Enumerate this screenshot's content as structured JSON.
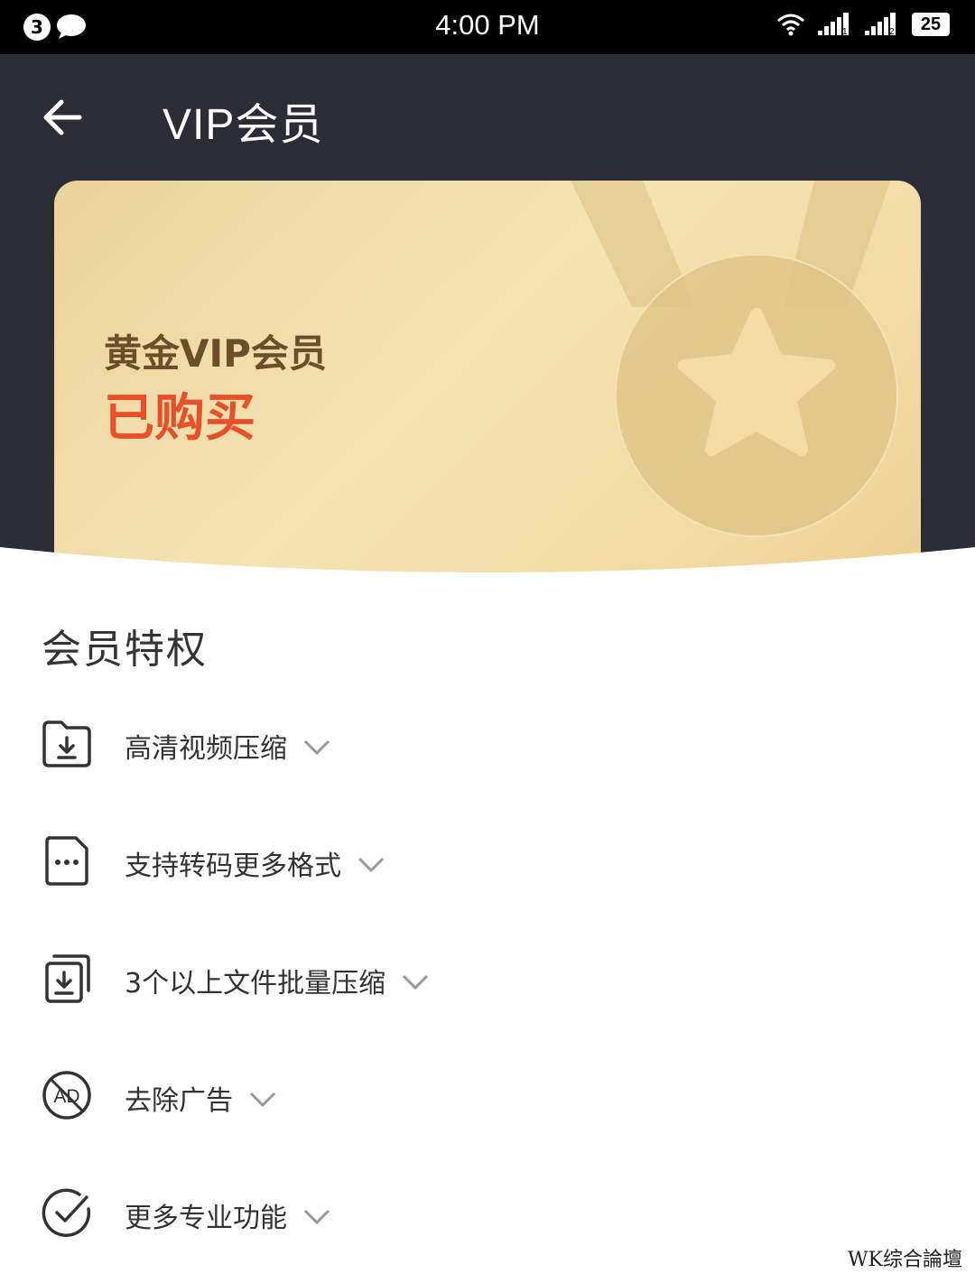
{
  "status_bar": {
    "notification_count": "3",
    "time": "4:00 PM",
    "battery": "25",
    "sim1": "1",
    "sim2": "2"
  },
  "header": {
    "title": "VIP会员"
  },
  "card": {
    "title": "黄金VIP会员",
    "status": "已购买"
  },
  "section": {
    "title": "会员特权",
    "features": [
      {
        "label": "高清视频压缩",
        "icon": "folder-download-icon"
      },
      {
        "label": "支持转码更多格式",
        "icon": "document-more-icon"
      },
      {
        "label": "3个以上文件批量压缩",
        "icon": "batch-download-icon"
      },
      {
        "label": "去除广告",
        "icon": "no-ad-icon"
      },
      {
        "label": "更多专业功能",
        "icon": "check-circle-icon"
      }
    ]
  },
  "watermark": "WK综合論壇",
  "colors": {
    "header_bg": "#2b2c36",
    "card_gold": "#f2dba3",
    "status_orange": "#e8502a",
    "title_brown": "#6a4f2a"
  }
}
